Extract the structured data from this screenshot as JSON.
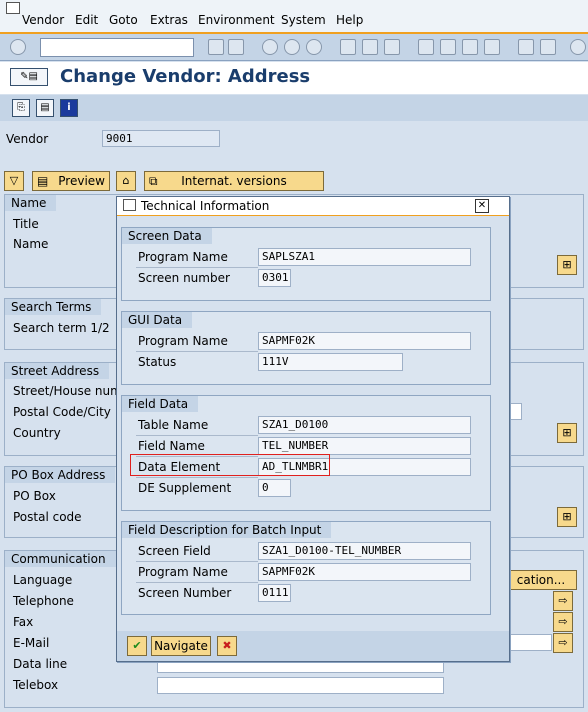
{
  "menu": [
    "Vendor",
    "Edit",
    "Goto",
    "Extras",
    "Environment",
    "System",
    "Help"
  ],
  "title": "Change Vendor: Address",
  "vendor": {
    "label": "Vendor",
    "value": "9001"
  },
  "toolbar": {
    "preview": "Preview",
    "internat": "Internat. versions"
  },
  "groups": {
    "name": {
      "title": "Name",
      "title_label": "Title",
      "name_label": "Name"
    },
    "search": {
      "title": "Search Terms",
      "term": "Search term 1/2"
    },
    "street": {
      "title": "Street Address",
      "house": "Street/House numb",
      "postal": "Postal Code/City",
      "country": "Country"
    },
    "pobox": {
      "title": "PO Box Address",
      "pobox": "PO Box",
      "postal": "Postal code"
    },
    "comm": {
      "title": "Communication",
      "language": "Language",
      "telephone": "Telephone",
      "fax": "Fax",
      "email": "E-Mail",
      "dataline": "Data line",
      "telebox": "Telebox",
      "other_btn": "cation..."
    }
  },
  "dialog": {
    "title": "Technical Information",
    "screen": {
      "title": "Screen Data",
      "rows": [
        {
          "label": "Program Name",
          "value": "SAPLSZA1"
        },
        {
          "label": "Screen number",
          "value": "0301"
        }
      ]
    },
    "gui": {
      "title": "GUI Data",
      "rows": [
        {
          "label": "Program Name",
          "value": "SAPMF02K"
        },
        {
          "label": "Status",
          "value": "111V"
        }
      ]
    },
    "field": {
      "title": "Field Data",
      "rows": [
        {
          "label": "Table Name",
          "value": "SZA1_D0100"
        },
        {
          "label": "Field Name",
          "value": "TEL_NUMBER"
        },
        {
          "label": "Data Element",
          "value": "AD_TLNMBR1"
        },
        {
          "label": "DE Supplement",
          "value": "0"
        }
      ]
    },
    "batch": {
      "title": "Field Description for Batch Input",
      "rows": [
        {
          "label": "Screen Field",
          "value": "SZA1_D0100-TEL_NUMBER"
        },
        {
          "label": "Program Name",
          "value": "SAPMF02K"
        },
        {
          "label": "Screen Number",
          "value": "0111"
        }
      ]
    },
    "navigate": "Navigate"
  },
  "colors": {
    "highlight": "#e0201e",
    "accent": "#f0a020"
  }
}
